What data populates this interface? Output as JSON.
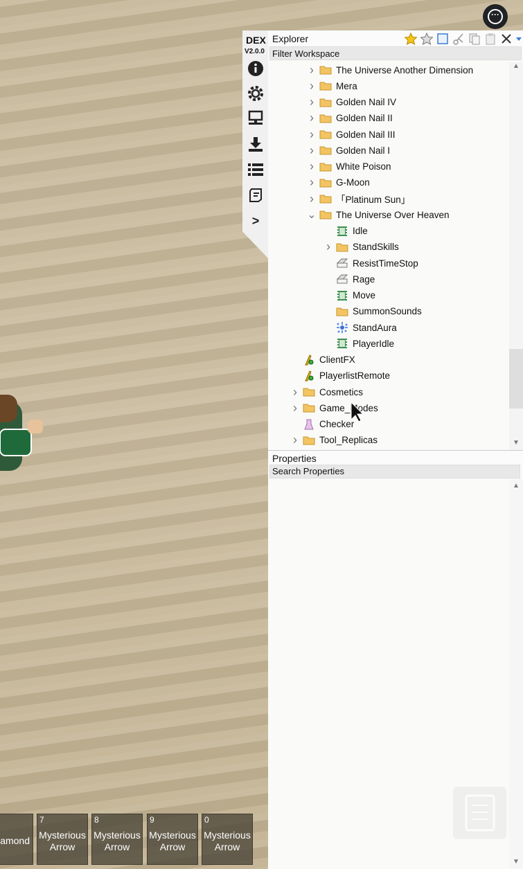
{
  "dex": {
    "title": "DEX",
    "version": "V2.0.0",
    "side_icons": [
      "info-icon",
      "gear-icon",
      "network-icon",
      "download-icon",
      "list-icon",
      "script-icon",
      "console-icon"
    ],
    "console_glyph": ">"
  },
  "explorer": {
    "title": "Explorer",
    "filter_placeholder": "Filter Workspace",
    "toolbar_icons": [
      "star-icon",
      "star-outline-icon",
      "select-icon",
      "cut-icon",
      "copy-icon",
      "paste-icon",
      "close-icon",
      "dropdown-icon"
    ],
    "items": [
      {
        "label": "The Universe Another Dimension",
        "depth": 2,
        "icon": "folder-icon",
        "arrow": "right"
      },
      {
        "label": "Mera",
        "depth": 2,
        "icon": "folder-icon",
        "arrow": "right"
      },
      {
        "label": "Golden Nail IV",
        "depth": 2,
        "icon": "folder-icon",
        "arrow": "right"
      },
      {
        "label": "Golden Nail II",
        "depth": 2,
        "icon": "folder-icon",
        "arrow": "right"
      },
      {
        "label": "Golden Nail III",
        "depth": 2,
        "icon": "folder-icon",
        "arrow": "right"
      },
      {
        "label": "Golden Nail I",
        "depth": 2,
        "icon": "folder-icon",
        "arrow": "right"
      },
      {
        "label": "White Poison",
        "depth": 2,
        "icon": "folder-icon",
        "arrow": "right"
      },
      {
        "label": "G-Moon",
        "depth": 2,
        "icon": "folder-icon",
        "arrow": "right"
      },
      {
        "label": "「Platinum Sun」",
        "depth": 2,
        "icon": "folder-icon",
        "arrow": "right"
      },
      {
        "label": "The Universe Over Heaven",
        "depth": 2,
        "icon": "folder-icon",
        "arrow": "down"
      },
      {
        "label": "Idle",
        "depth": 3,
        "icon": "animation-icon",
        "arrow": "none"
      },
      {
        "label": "StandSkills",
        "depth": 3,
        "icon": "folder-icon",
        "arrow": "right"
      },
      {
        "label": "ResistTimeStop",
        "depth": 3,
        "icon": "value-icon",
        "arrow": "none"
      },
      {
        "label": "Rage",
        "depth": 3,
        "icon": "value-icon",
        "arrow": "none"
      },
      {
        "label": "Move",
        "depth": 3,
        "icon": "animation-icon",
        "arrow": "none"
      },
      {
        "label": "SummonSounds",
        "depth": 3,
        "icon": "folder-icon",
        "arrow": "none"
      },
      {
        "label": "StandAura",
        "depth": 3,
        "icon": "particle-icon",
        "arrow": "none"
      },
      {
        "label": "PlayerIdle",
        "depth": 3,
        "icon": "animation-icon",
        "arrow": "none"
      },
      {
        "label": "ClientFX",
        "depth": 1,
        "icon": "remote-event-icon",
        "arrow": "none"
      },
      {
        "label": "PlayerlistRemote",
        "depth": 1,
        "icon": "remote-event-icon",
        "arrow": "none"
      },
      {
        "label": "Cosmetics",
        "depth": 1,
        "icon": "folder-icon",
        "arrow": "right"
      },
      {
        "label": "Game_Modes",
        "depth": 1,
        "icon": "folder-icon",
        "arrow": "right"
      },
      {
        "label": "Checker",
        "depth": 1,
        "icon": "bindable-icon",
        "arrow": "none"
      },
      {
        "label": "Tool_Replicas",
        "depth": 1,
        "icon": "folder-icon",
        "arrow": "right"
      }
    ]
  },
  "properties": {
    "title": "Properties",
    "search_placeholder": "Search Properties"
  },
  "hotbar": [
    {
      "number": "",
      "label": "amond"
    },
    {
      "number": "7",
      "label": "Mysterious Arrow"
    },
    {
      "number": "8",
      "label": "Mysterious Arrow"
    },
    {
      "number": "9",
      "label": "Mysterious Arrow"
    },
    {
      "number": "0",
      "label": "Mysterious Arrow"
    }
  ],
  "colors": {
    "folder": "#f2c462",
    "panel_bg": "#fafaf9",
    "sand": "#c7b89a",
    "hotbar_slot": "#4b4537"
  }
}
